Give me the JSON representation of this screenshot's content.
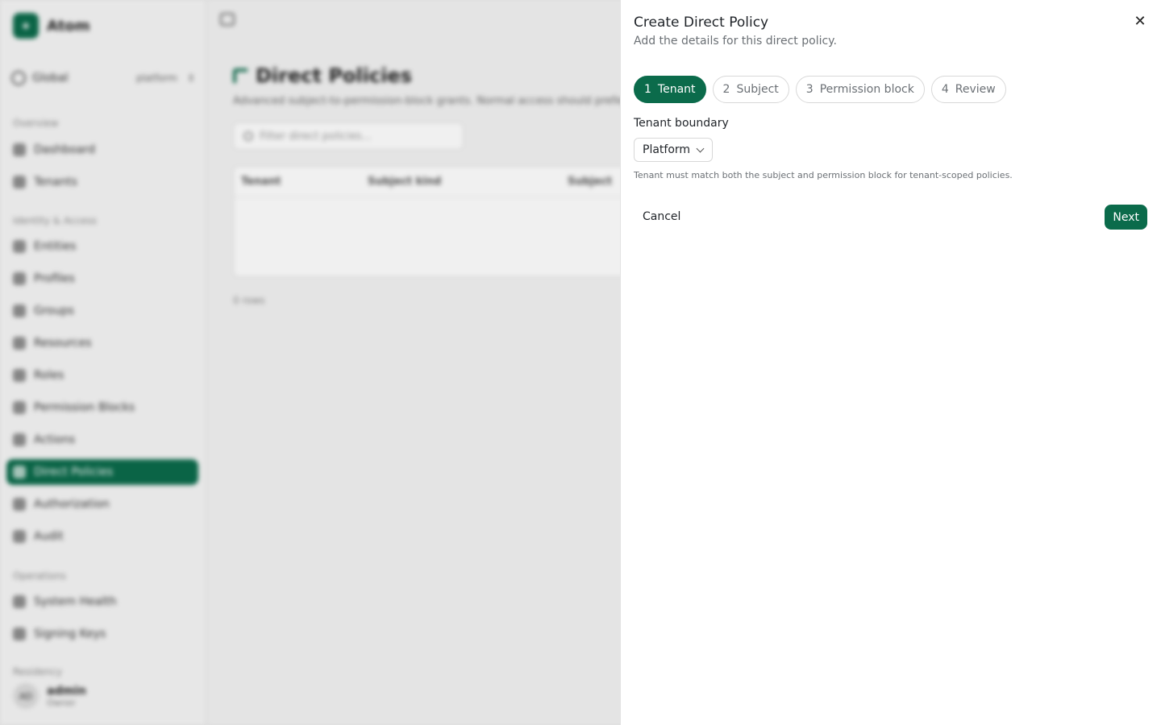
{
  "app": {
    "brand": "Atom",
    "scope": {
      "label": "Global",
      "value": "platform"
    },
    "nav": {
      "sections": [
        "Overview",
        "Identity & Access",
        "Operations",
        "Residency"
      ],
      "items": [
        "Dashboard",
        "Tenants",
        "Entities",
        "Profiles",
        "Groups",
        "Resources",
        "Roles",
        "Permission Blocks",
        "Actions",
        "Direct Policies",
        "Authorization",
        "Audit",
        "System Health",
        "Signing Keys"
      ]
    },
    "user": {
      "initials": "AD",
      "name": "admin",
      "role": "Owner"
    }
  },
  "page": {
    "title": "Direct Policies",
    "description": "Advanced subject-to-permission-block grants. Normal access should prefer roles.",
    "filter_placeholder": "Filter direct policies...",
    "columns": [
      "Tenant",
      "Subject kind",
      "Subject"
    ],
    "footer": "0 rows"
  },
  "drawer": {
    "title": "Create Direct Policy",
    "subtitle": "Add the details for this direct policy.",
    "steps": [
      {
        "num": "1",
        "label": "Tenant"
      },
      {
        "num": "2",
        "label": "Subject"
      },
      {
        "num": "3",
        "label": "Permission block"
      },
      {
        "num": "4",
        "label": "Review"
      }
    ],
    "field_label": "Tenant boundary",
    "select_value": "Platform",
    "help": "Tenant must match both the subject and permission block for tenant-scoped policies.",
    "cancel": "Cancel",
    "next": "Next",
    "accent_color": "#0b6b4b"
  }
}
